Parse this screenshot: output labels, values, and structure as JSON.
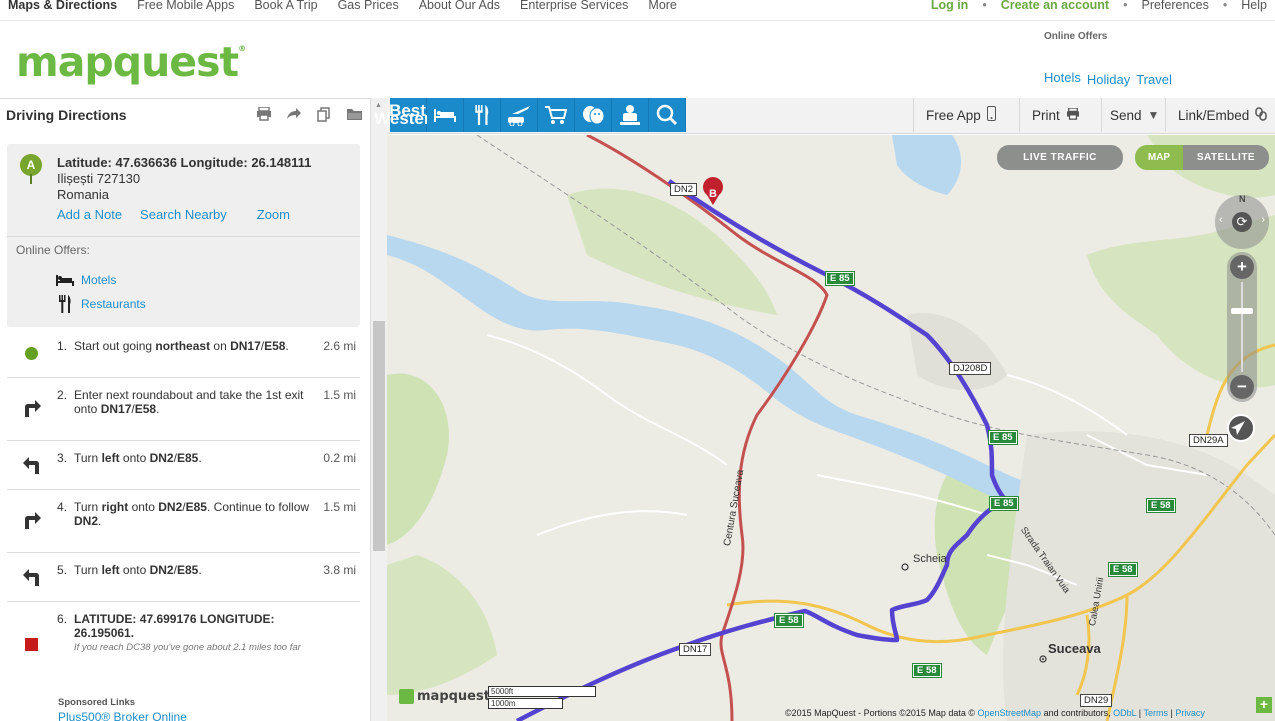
{
  "topnav": {
    "left": [
      "Maps & Directions",
      "Free Mobile Apps",
      "Book A Trip",
      "Gas Prices",
      "About Our Ads",
      "Enterprise Services",
      "More"
    ],
    "login": "Log in",
    "create_account": "Create an account",
    "preferences": "Preferences",
    "help": "Help",
    "separator": "•"
  },
  "header": {
    "logo": "mapquest",
    "online_offers_title": "Online Offers",
    "offer_links": [
      "Hotels",
      "Holiday",
      "Travel"
    ]
  },
  "panel": {
    "title": "Driving Directions",
    "tools": [
      "printer-icon",
      "share-icon",
      "copy-icon",
      "folder-icon"
    ],
    "location": {
      "marker": "A",
      "latlong": "Latitude: 47.636636 Longitude: 26.148111",
      "city": "Ilișești 727130",
      "country": "Romania",
      "actions": [
        "Add a Note",
        "Search Nearby",
        "Zoom"
      ],
      "offers_label": "Online Offers:",
      "offers": [
        "Motels",
        "Restaurants"
      ]
    },
    "steps": [
      {
        "num": "1.",
        "parts": [
          "Start out going ",
          "northeast",
          " on ",
          "DN17",
          "/",
          "E58",
          "."
        ],
        "dist": "2.6 mi",
        "icon": "start-dot"
      },
      {
        "num": "2.",
        "parts": [
          "Enter next roundabout and take the 1st exit onto ",
          "DN17",
          "/",
          "E58",
          "."
        ],
        "dist": "1.5 mi",
        "icon": "turn-right-icon"
      },
      {
        "num": "3.",
        "parts": [
          "Turn ",
          "left",
          " onto ",
          "DN2",
          "/",
          "E85",
          "."
        ],
        "dist": "0.2 mi",
        "icon": "turn-left-icon"
      },
      {
        "num": "4.",
        "parts": [
          "Turn ",
          "right",
          " onto ",
          "DN2",
          "/",
          "E85",
          ". Continue to follow ",
          "DN2",
          "."
        ],
        "dist": "1.5 mi",
        "icon": "turn-right-icon"
      },
      {
        "num": "5.",
        "parts": [
          "Turn ",
          "left",
          " onto ",
          "DN2",
          "/",
          "E85",
          "."
        ],
        "dist": "3.8 mi",
        "icon": "turn-left-icon"
      },
      {
        "num": "6.",
        "title": "LATITUDE: 47.699176 LONGITUDE: 26.195061.",
        "note": "If you reach DC38 you've gone about 2.1 miles too far",
        "icon": "end-square"
      }
    ],
    "sponsored_title": "Sponsored Links",
    "sponsored_link": "Plus500® Broker Online"
  },
  "toolbar": {
    "categories": [
      "Best Western",
      "hotel-icon",
      "restaurant-icon",
      "travel-icon",
      "shopping-icon",
      "entertainment-icon",
      "services-icon",
      "search-icon"
    ],
    "free_app": "Free App",
    "print": "Print",
    "send": "Send",
    "link_embed": "Link/Embed"
  },
  "map": {
    "live_traffic": "LIVE TRAFFIC",
    "map_btn": "MAP",
    "satellite_btn": "SATELLITE",
    "compass_n": "N",
    "road_labels": [
      "DN2",
      "DJ208D",
      "DN29A",
      "DN17",
      "DN29"
    ],
    "shields": [
      "E 85",
      "E 85",
      "E 85",
      "E 58",
      "E 58",
      "E 58",
      "E 58"
    ],
    "towns": [
      "Scheia",
      "Suceava"
    ],
    "street_labels": [
      "Centura Suceava",
      "Strada Traian Vuia",
      "Calea Unirii"
    ],
    "destination_marker": "B",
    "brand": "mapquest",
    "scale": [
      "5000ft",
      "1000m"
    ],
    "copyright_text": "©2015 MapQuest  -  Portions ©2015  Map data ©",
    "copyright_osm": "OpenStreetMap",
    "copyright_and": " and contributors, ",
    "copyright_odbl": "ODbL",
    "copyright_sep": " | ",
    "copyright_terms": "Terms",
    "copyright_privacy": "Privacy",
    "colors": {
      "route": "#5542d0",
      "river": "#b8d8f0",
      "green": "#cfe2b4",
      "shield": "#2a8a3c",
      "road_red": "#c45050"
    }
  }
}
